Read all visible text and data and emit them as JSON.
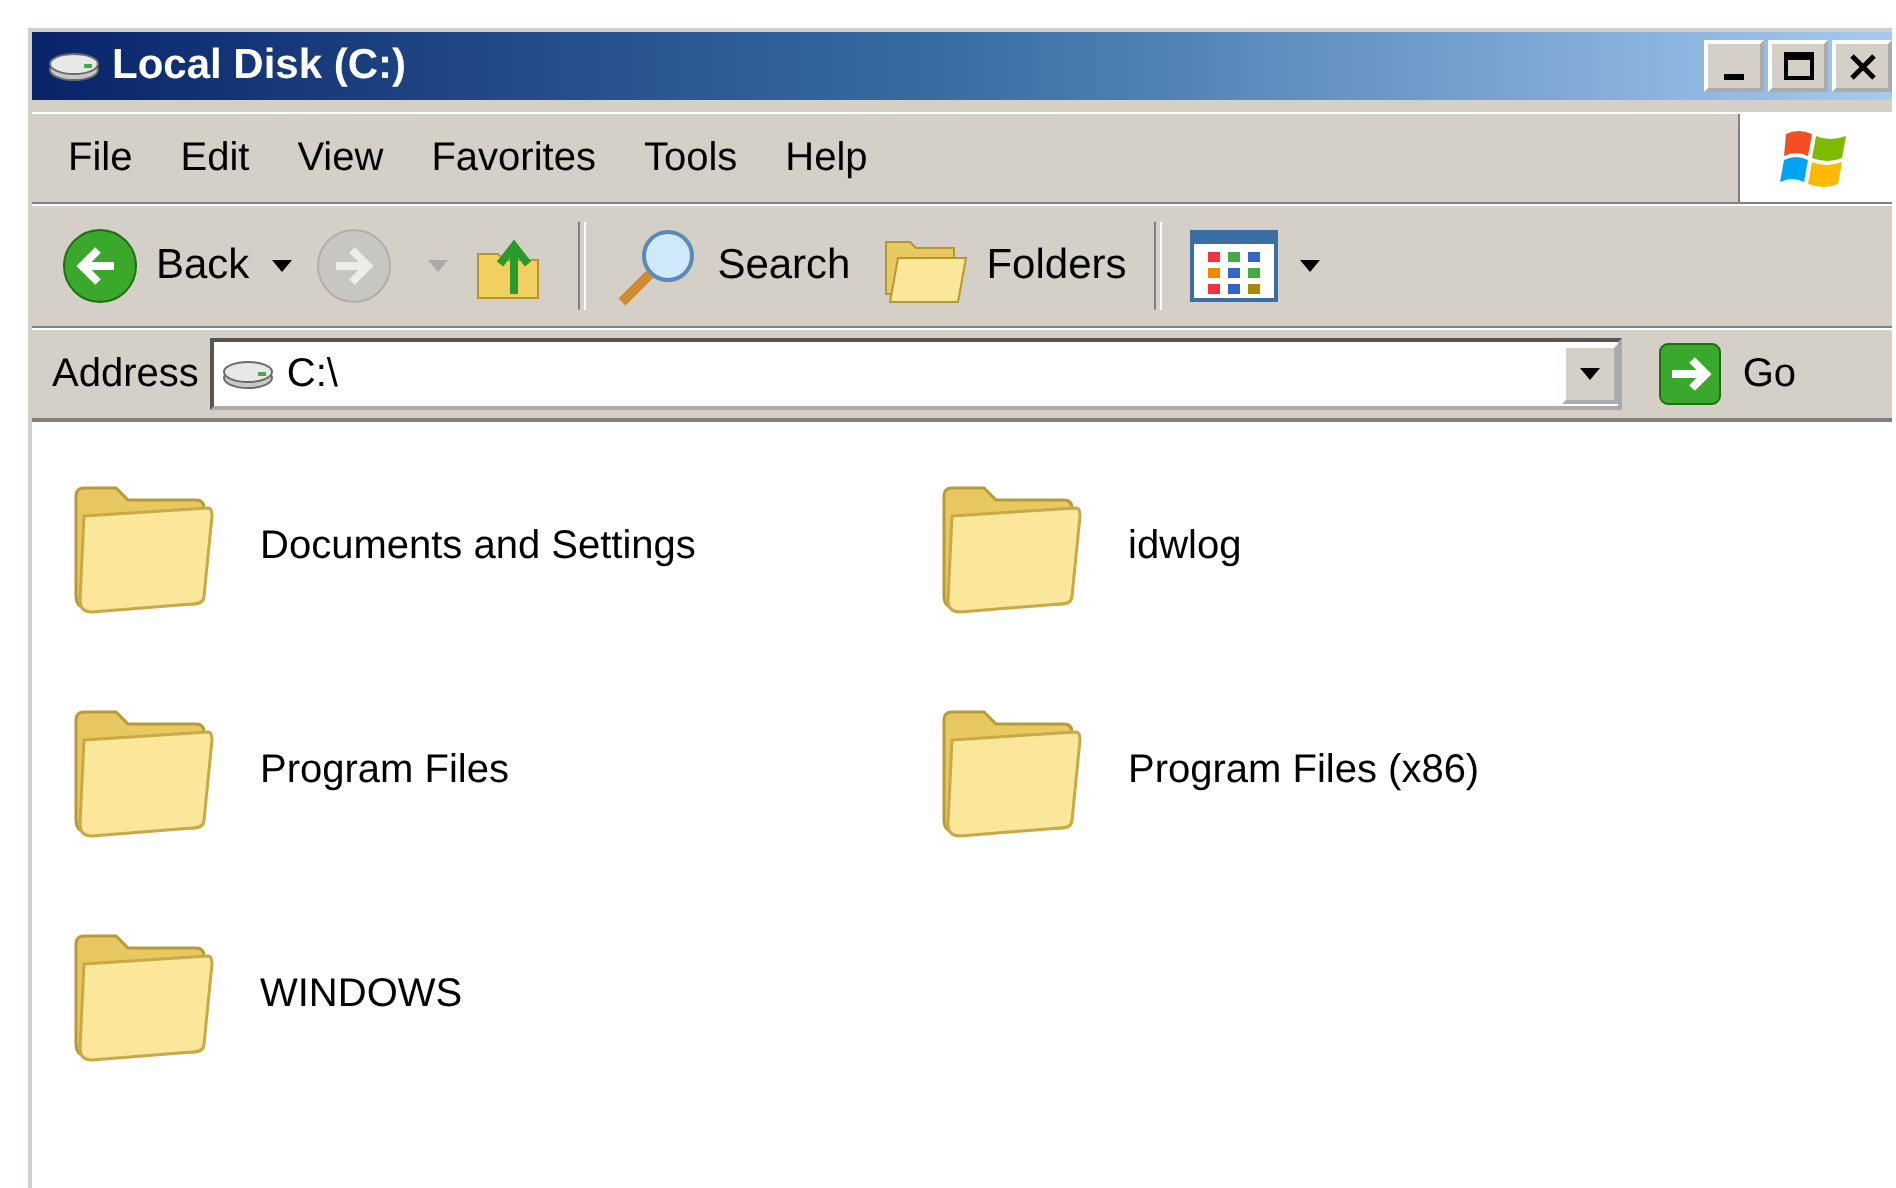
{
  "window": {
    "title": "Local Disk (C:)"
  },
  "menu": [
    "File",
    "Edit",
    "View",
    "Favorites",
    "Tools",
    "Help"
  ],
  "toolbar": [
    {
      "kind": "back",
      "label": "Back",
      "disabled": false
    },
    {
      "kind": "forward",
      "disabled": true
    },
    {
      "kind": "up",
      "disabled": false
    },
    {
      "kind": "separator"
    },
    {
      "kind": "search",
      "label": "Search",
      "disabled": false
    },
    {
      "kind": "folders",
      "label": "Folders",
      "disabled": false
    },
    {
      "kind": "separator"
    },
    {
      "kind": "views",
      "disabled": false
    }
  ],
  "address": {
    "label": "Address",
    "value": "C:\\",
    "go": "Go"
  },
  "folders": [
    {
      "name": "Documents and Settings"
    },
    {
      "name": "idwlog"
    },
    {
      "name": "Program Files"
    },
    {
      "name": "Program Files (x86)"
    },
    {
      "name": "WINDOWS"
    }
  ]
}
